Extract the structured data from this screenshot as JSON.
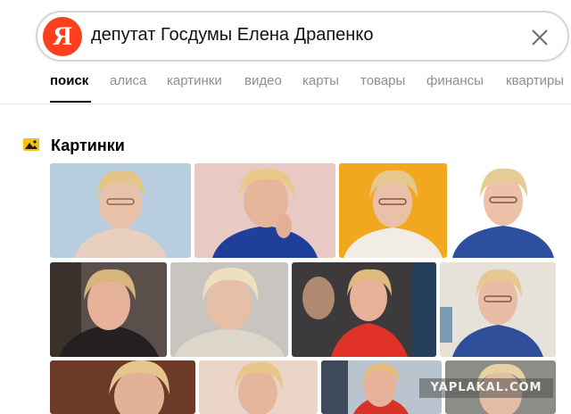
{
  "search": {
    "logo_letter": "Я",
    "query": "депутат Госдумы Елена Драпенко"
  },
  "tabs": [
    {
      "label": "поиск",
      "active": true
    },
    {
      "label": "алиса"
    },
    {
      "label": "картинки"
    },
    {
      "label": "видео"
    },
    {
      "label": "карты"
    },
    {
      "label": "товары"
    },
    {
      "label": "финансы"
    },
    {
      "label": "квартиры"
    }
  ],
  "images_section": {
    "title": "Картинки",
    "icon": "image-icon",
    "accent_color": "#f4c20d"
  },
  "watermark": "YAPLAKAL.COM",
  "colors": {
    "brand": "#fc3f1d",
    "tab_inactive": "#8d8f95"
  }
}
